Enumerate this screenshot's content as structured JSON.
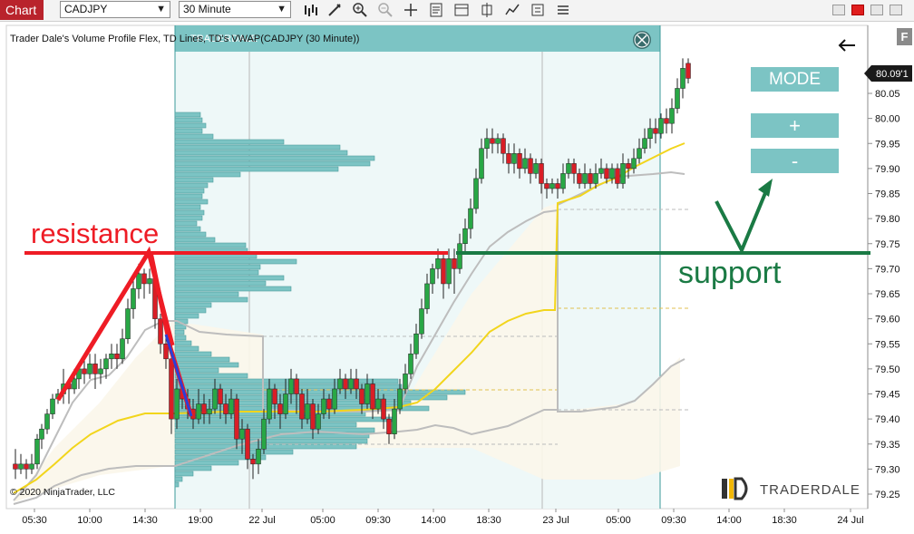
{
  "toolbar": {
    "tab_label": "Chart",
    "instrument": "CADJPY",
    "timeframe": "30 Minute",
    "tools": [
      "bars-icon",
      "pencil-icon",
      "zoom-in-icon",
      "zoom-out-icon",
      "crosshair-icon",
      "properties-icon",
      "strategy-icon",
      "chart-trader-icon",
      "indicator-icon",
      "data-box-icon"
    ]
  },
  "chart": {
    "indicator_caption": "Trader Dale's Volume Profile Flex, TD Lines, TD's VWAP(CADJPY (30 Minute))",
    "watermark": "TRADERDALE",
    "copyright": "© 2020 NinjaTrader, LLC",
    "brand": "TRADERDALE",
    "last_price": "80.09'1",
    "mode_label": "MODE",
    "plus_label": "+",
    "minus_label": "-",
    "f_label": "F",
    "annotations": {
      "resistance": "resistance",
      "support": "support"
    },
    "colors": {
      "up_candle": "#28a745",
      "down_candle": "#d91e26",
      "profile": "#7cc4c4",
      "vwap": "#f2d51c",
      "band": "#bdbdbd",
      "resistance": "#ee1c25",
      "support": "#1a7a44",
      "arrow": "#1a7a44",
      "blue_line": "#2b3fd6"
    }
  },
  "chart_data": {
    "type": "candlestick",
    "title": "",
    "y_ticks": [
      "80.05",
      "80.00",
      "79.95",
      "79.90",
      "79.85",
      "79.80",
      "79.75",
      "79.70",
      "79.65",
      "79.60",
      "79.55",
      "79.50",
      "79.45",
      "79.40",
      "79.35",
      "79.30",
      "79.25"
    ],
    "x_ticks": [
      "05:30",
      "10:00",
      "14:30",
      "19:00",
      "22 Jul",
      "05:00",
      "09:30",
      "14:00",
      "18:30",
      "23 Jul",
      "05:00",
      "09:30",
      "14:00",
      "18:30",
      "24 Jul"
    ],
    "ylim": [
      79.23,
      80.145
    ],
    "resistance_level": 79.735,
    "support_level": 79.735
  }
}
